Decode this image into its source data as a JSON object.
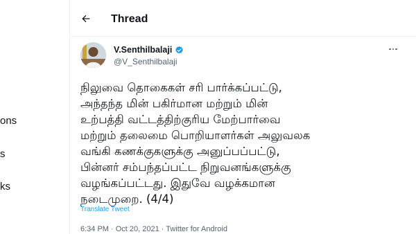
{
  "left_nav": {
    "items": [
      "ons",
      "s",
      "ks"
    ]
  },
  "header": {
    "back_icon": "arrow-left-icon",
    "title": "Thread"
  },
  "tweet": {
    "display_name": "V.Senthilbalaji",
    "handle": "@V_Senthilbalaji",
    "verified": true,
    "body": "நிலுவை தொகைகள் சரி பார்க்கப்பட்டு,\nஅந்தந்த மின் பகிர்மான மற்றும் மின்\nஉற்பத்தி வட்டத்திற்குரிய மேற்பார்வை\nமற்றும் தலைமை பொறியாளர்கள் அலுவலக\nவங்கி கணக்குகளுக்கு அனுப்பப்பட்டு,\nபின்னர் சம்பந்தப்பட்ட நிறுவனங்களுக்கு\nவழங்கப்பட்டது. இதுவே வழக்கமான\nநடைமுறை. (4/4)",
    "translate_label": "Translate Tweet",
    "meta": "6:34 PM · Oct 20, 2021 · Twitter for Android"
  },
  "colors": {
    "link": "#1d9bf0",
    "secondary_text": "#536471",
    "border": "#eff3f4"
  }
}
